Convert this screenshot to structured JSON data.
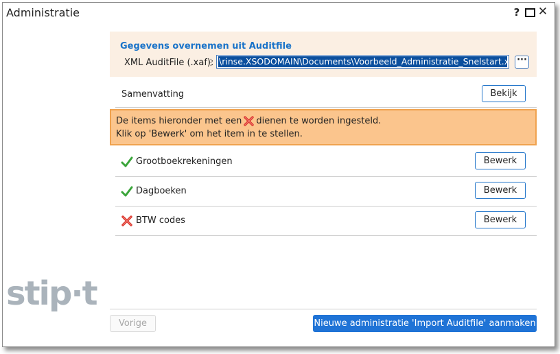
{
  "window": {
    "title": "Administratie",
    "help": "?",
    "close": "✕"
  },
  "logo": {
    "text": "stip·t"
  },
  "auditfile": {
    "section_title": "Gegevens overnemen uit Auditfile",
    "field_label": "XML AuditFile (.xaf):",
    "handle": "⋮",
    "path_value": "\\rinse.XSODOMAIN\\Documents\\Voorbeeld_Administratie_Snelstart.xaf",
    "browse_label": "···"
  },
  "summary": {
    "label": "Samenvatting",
    "button": "Bekijk"
  },
  "warning": {
    "line1_before": "De items hieronder met een",
    "line1_after": "dienen te worden ingesteld.",
    "line2": "Klik op 'Bewerk' om het item in te stellen."
  },
  "items": [
    {
      "label": "Grootboekrekeningen",
      "status_icon": "check-icon",
      "button": "Bewerk"
    },
    {
      "label": "Dagboeken",
      "status_icon": "check-icon",
      "button": "Bewerk"
    },
    {
      "label": "BTW codes",
      "status_icon": "cross-icon",
      "button": "Bewerk"
    }
  ],
  "footer": {
    "prev_label": "Vorige",
    "create_label": "Nieuwe administratie 'Import Auditfile' aanmaken"
  },
  "colors": {
    "accent": "#1f73d6",
    "panel_bg": "#fbefe3",
    "warning_bg": "#fbc58d",
    "warning_border": "#f0a24e",
    "check": "#3aa53a",
    "cross": "#d9342b"
  }
}
